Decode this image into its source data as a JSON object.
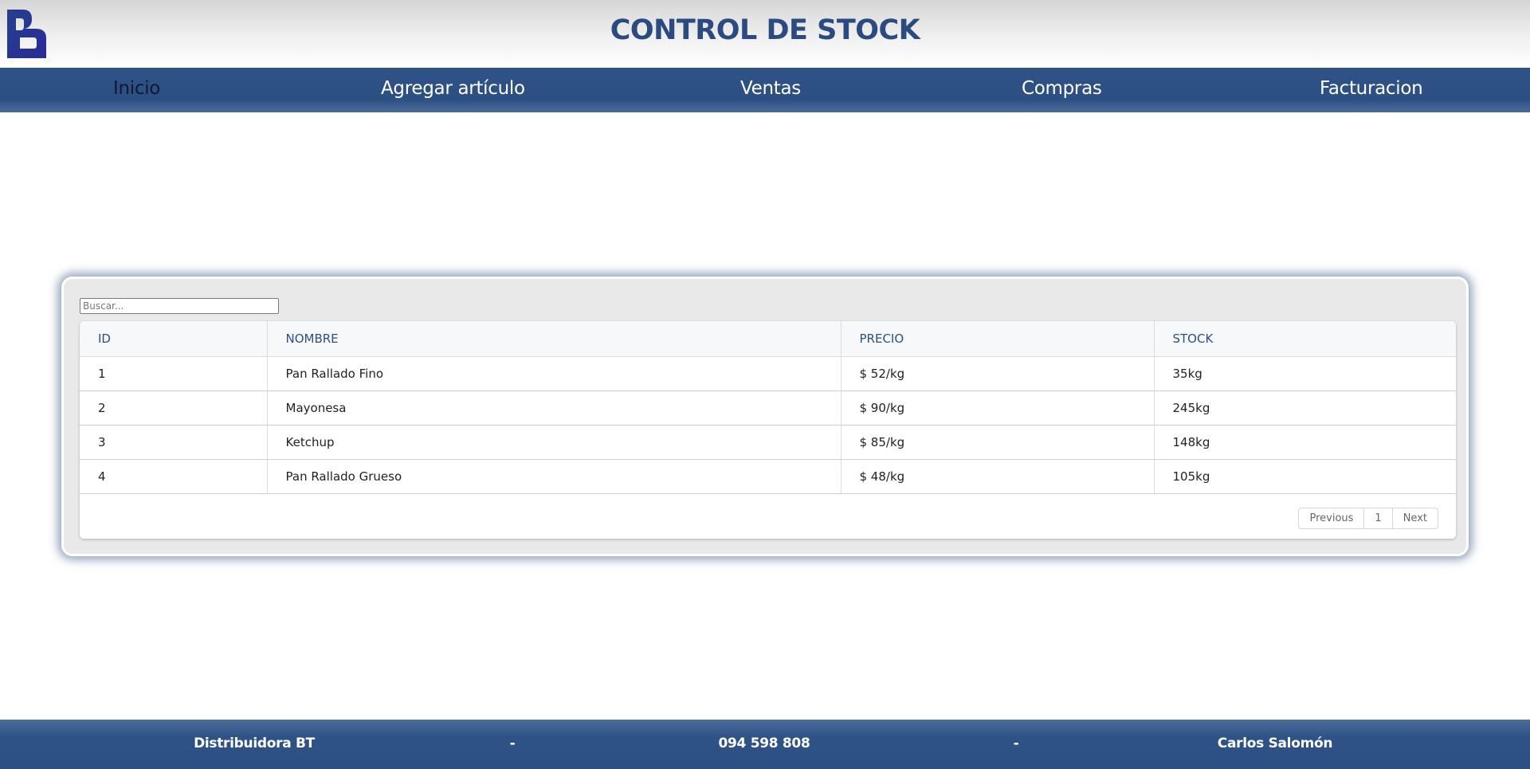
{
  "header": {
    "title": "CONTROL DE STOCK",
    "brand_color": "#2a4a80"
  },
  "nav": {
    "items": [
      {
        "label": "Inicio",
        "active": true
      },
      {
        "label": "Agregar artículo"
      },
      {
        "label": "Ventas"
      },
      {
        "label": "Compras"
      },
      {
        "label": "Facturacion"
      }
    ],
    "background_color": "#2c4f84"
  },
  "search": {
    "placeholder": "Buscar...",
    "value": ""
  },
  "table": {
    "columns": [
      "ID",
      "NOMBRE",
      "PRECIO",
      "STOCK"
    ],
    "rows": [
      [
        "1",
        "Pan Rallado Fino",
        "$ 52/kg",
        "35kg"
      ],
      [
        "2",
        "Mayonesa",
        "$ 90/kg",
        "245kg"
      ],
      [
        "3",
        "Ketchup",
        "$ 85/kg",
        "148kg"
      ],
      [
        "4",
        "Pan Rallado Grueso",
        "$ 48/kg",
        "105kg"
      ]
    ]
  },
  "pagination": {
    "previous_label": "Previous",
    "current_page": "1",
    "next_label": "Next"
  },
  "footer": {
    "company": "Distribuidora BT",
    "separator_1": "-",
    "phone": "094 598 808",
    "separator_2": "-",
    "author": "Carlos Salomón"
  }
}
